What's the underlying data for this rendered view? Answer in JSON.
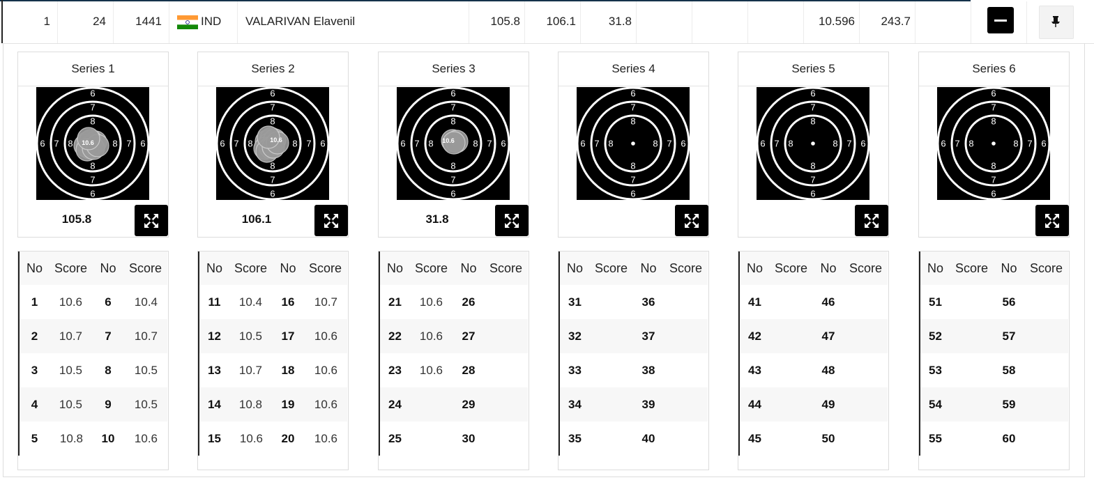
{
  "athlete_row": {
    "rank": "1",
    "bib": "24",
    "id": "1441",
    "country": "IND",
    "name": "VALARIVAN Elavenil",
    "s1": "105.8",
    "s2": "106.1",
    "s3": "31.8",
    "avg": "10.596",
    "total": "243.7",
    "flag_colors": [
      "#ff9933",
      "#ffffff",
      "#138808"
    ]
  },
  "table_headers": {
    "no": "No",
    "score": "Score"
  },
  "series": [
    {
      "title": "Series 1",
      "total": "105.8",
      "label": "10.6",
      "rows": [
        [
          "1",
          "10.6",
          "6",
          "10.4"
        ],
        [
          "2",
          "10.7",
          "7",
          "10.7"
        ],
        [
          "3",
          "10.5",
          "8",
          "10.5"
        ],
        [
          "4",
          "10.5",
          "9",
          "10.5"
        ],
        [
          "5",
          "10.8",
          "10",
          "10.6"
        ]
      ]
    },
    {
      "title": "Series 2",
      "total": "106.1",
      "label": "10.6",
      "rows": [
        [
          "11",
          "10.4",
          "16",
          "10.7"
        ],
        [
          "12",
          "10.5",
          "17",
          "10.6"
        ],
        [
          "13",
          "10.7",
          "18",
          "10.6"
        ],
        [
          "14",
          "10.8",
          "19",
          "10.6"
        ],
        [
          "15",
          "10.6",
          "20",
          "10.6"
        ]
      ]
    },
    {
      "title": "Series 3",
      "total": "31.8",
      "label": "10.6",
      "rows": [
        [
          "21",
          "10.6",
          "26",
          ""
        ],
        [
          "22",
          "10.6",
          "27",
          ""
        ],
        [
          "23",
          "10.6",
          "28",
          ""
        ],
        [
          "24",
          "",
          "29",
          ""
        ],
        [
          "25",
          "",
          "30",
          ""
        ]
      ]
    },
    {
      "title": "Series 4",
      "total": "",
      "label": "",
      "rows": [
        [
          "31",
          "",
          "36",
          ""
        ],
        [
          "32",
          "",
          "37",
          ""
        ],
        [
          "33",
          "",
          "38",
          ""
        ],
        [
          "34",
          "",
          "39",
          ""
        ],
        [
          "35",
          "",
          "40",
          ""
        ]
      ]
    },
    {
      "title": "Series 5",
      "total": "",
      "label": "",
      "rows": [
        [
          "41",
          "",
          "46",
          ""
        ],
        [
          "42",
          "",
          "47",
          ""
        ],
        [
          "43",
          "",
          "48",
          ""
        ],
        [
          "44",
          "",
          "49",
          ""
        ],
        [
          "45",
          "",
          "50",
          ""
        ]
      ]
    },
    {
      "title": "Series 6",
      "total": "",
      "label": "",
      "rows": [
        [
          "51",
          "",
          "56",
          ""
        ],
        [
          "52",
          "",
          "57",
          ""
        ],
        [
          "53",
          "",
          "58",
          ""
        ],
        [
          "54",
          "",
          "59",
          ""
        ],
        [
          "55",
          "",
          "60",
          ""
        ]
      ]
    }
  ],
  "target_ring_labels": [
    "6",
    "7",
    "8"
  ],
  "icons": {
    "collapse": "minus-icon",
    "pin": "pin-icon",
    "expand": "expand-icon"
  }
}
